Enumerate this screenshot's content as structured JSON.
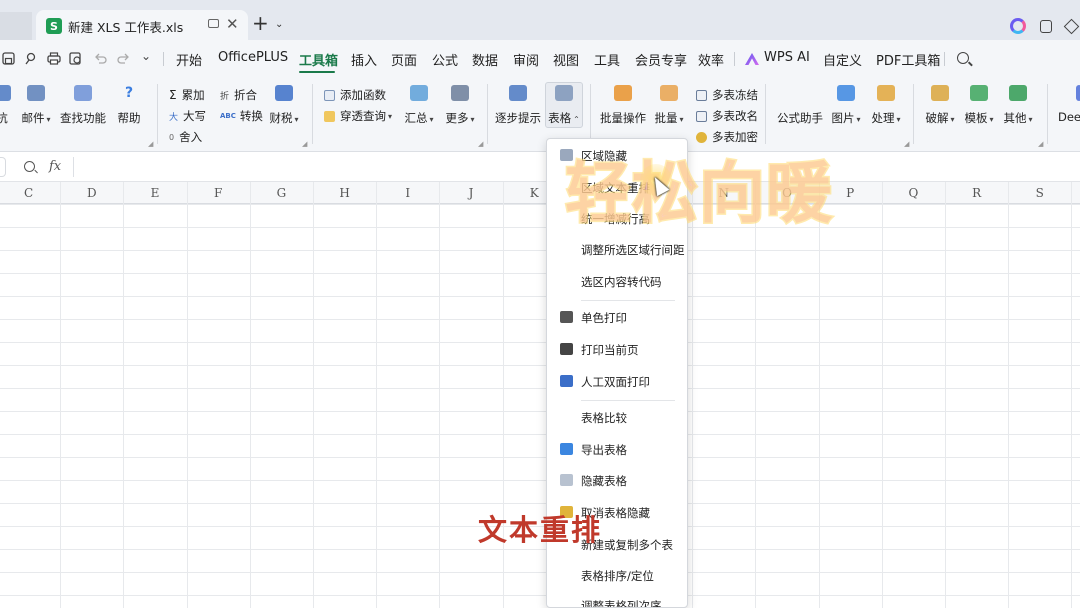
{
  "titlebar": {
    "doc_tab_title": "新建 XLS 工作表.xls",
    "app_logo_letter": "S",
    "close_glyph": "✕",
    "new_tab_glyph": "+",
    "new_tab_caret": "⌄"
  },
  "menu": {
    "quick_redo_caret": "⌄",
    "items": [
      "开始",
      "OfficePLUS",
      "工具箱",
      "插入",
      "页面",
      "公式",
      "数据",
      "审阅",
      "视图",
      "工具",
      "会员专享",
      "效率",
      "WPS AI",
      "自定义",
      "PDF工具箱"
    ],
    "active_index": 2
  },
  "ribbon": {
    "big_buttons": [
      {
        "label": "抗",
        "icon": "arrow-icon",
        "color": "#4a78c2"
      },
      {
        "label": "邮件",
        "icon": "mail-icon",
        "color": "#5a7fb8",
        "caret": true
      },
      {
        "label": "查找功能",
        "icon": "find-icon",
        "color": "#6b8fd6"
      },
      {
        "label": "帮助",
        "icon": "help-icon",
        "color": "#3b7ee0"
      },
      {
        "label": "财税",
        "icon": "tax-icon",
        "color": "#3b6ec8",
        "caret": true
      },
      {
        "label": "汇总",
        "icon": "summary-icon",
        "color": "#5a9fd8",
        "caret": true
      },
      {
        "label": "更多",
        "icon": "more-icon",
        "color": "#6a7d9a",
        "caret": true
      },
      {
        "label": "逐步提示",
        "icon": "step-tip-icon",
        "color": "#4a78c2"
      },
      {
        "label": "表格",
        "icon": "table-icon",
        "color": "#7d95b8",
        "caret": true
      },
      {
        "label": "批量操作",
        "icon": "batch-op-icon",
        "color": "#e8922c"
      },
      {
        "label": "批量",
        "icon": "batch-icon",
        "color": "#e8a24c",
        "caret": true
      },
      {
        "label": "公式助手",
        "icon": "fx-icon",
        "color": "#555555"
      },
      {
        "label": "图片",
        "icon": "image-icon",
        "color": "#3b86e0",
        "caret": true
      },
      {
        "label": "处理",
        "icon": "process-icon",
        "color": "#e0a63b",
        "caret": true
      },
      {
        "label": "破解",
        "icon": "crack-icon",
        "color": "#d9a43b",
        "caret": true
      },
      {
        "label": "模板",
        "icon": "template-icon",
        "color": "#3ba55c",
        "caret": true
      },
      {
        "label": "其他",
        "icon": "other-icon",
        "color": "#2f9a52",
        "caret": true
      },
      {
        "label": "Deep",
        "icon": "deep-icon",
        "color": "#4a6cd8"
      }
    ],
    "small_buttons": [
      {
        "label": "累加",
        "icon": "sigma-icon",
        "glyph": "Σ"
      },
      {
        "label": "大写",
        "icon": "uppercase-icon",
        "glyph": "大"
      },
      {
        "label": "舍入",
        "icon": "round-icon",
        "glyph": "0"
      },
      {
        "label": "折合",
        "icon": "fold-icon",
        "glyph": "折"
      },
      {
        "label": "转换",
        "icon": "convert-icon",
        "glyph": "ABC"
      },
      {
        "label": "添加函数",
        "icon": "add-function-icon",
        "glyph": "fx"
      },
      {
        "label": "穿透查询",
        "icon": "drill-query-icon",
        "glyph": "⌕",
        "caret": true
      },
      {
        "label": "多表冻结",
        "icon": "freeze-icon",
        "glyph": "▦"
      },
      {
        "label": "多表改名",
        "icon": "rename-icon",
        "glyph": "▤"
      },
      {
        "label": "多表加密",
        "icon": "key-icon",
        "glyph": "⚷"
      }
    ]
  },
  "formula_bar": {
    "fx_label": "fx"
  },
  "grid": {
    "columns": [
      "C",
      "D",
      "E",
      "F",
      "G",
      "H",
      "I",
      "J",
      "K",
      "L",
      "M",
      "N",
      "O",
      "P",
      "Q",
      "R",
      "S"
    ]
  },
  "dropdown": {
    "items": [
      {
        "label": "区域隐藏",
        "icon": "region-hide-icon",
        "color": "#9aa8bd"
      },
      {
        "label": "区域文本重排",
        "icon": "",
        "color": ""
      },
      {
        "label": "统一增减行高",
        "icon": "",
        "color": ""
      },
      {
        "label": "调整所选区域行间距",
        "icon": "",
        "color": ""
      },
      {
        "label": "选区内容转代码",
        "icon": "",
        "color": ""
      },
      {
        "label": "单色打印",
        "icon": "mono-print-icon",
        "color": "#555555"
      },
      {
        "label": "打印当前页",
        "icon": "printer-icon",
        "color": "#444444"
      },
      {
        "label": "人工双面打印",
        "icon": "duplex-print-icon",
        "color": "#3b6ec8"
      },
      {
        "label": "表格比较",
        "icon": "",
        "color": ""
      },
      {
        "label": "导出表格",
        "icon": "export-table-icon",
        "color": "#3b86e0"
      },
      {
        "label": "隐藏表格",
        "icon": "hide-table-icon",
        "color": "#b8c2d0"
      },
      {
        "label": "取消表格隐藏",
        "icon": "unhide-table-icon",
        "color": "#e0b43b"
      },
      {
        "label": "新建或复制多个表",
        "icon": "",
        "color": ""
      },
      {
        "label": "表格排序/定位",
        "icon": "",
        "color": ""
      },
      {
        "label": "调整表格列次序",
        "icon": "",
        "color": ""
      }
    ]
  },
  "overlay": {
    "watermark": "轻松向暖",
    "caption": "文本重排"
  }
}
